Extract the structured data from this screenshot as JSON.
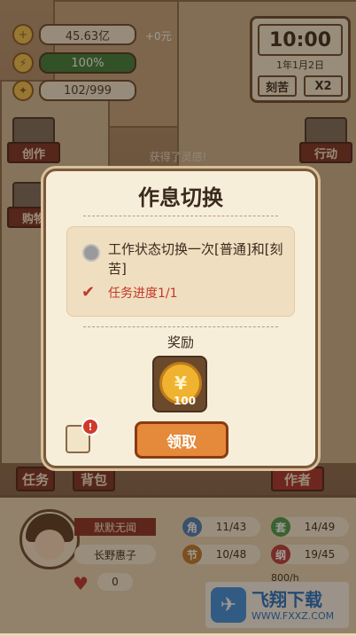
{
  "stats": {
    "money": "45.63亿",
    "money_delta": "+0元",
    "energy": "100%",
    "inspiration": "102/999",
    "money_icon": "coin-plus-icon",
    "energy_icon": "lightning-icon",
    "inspiration_icon": "bulb-icon"
  },
  "clock": {
    "time": "10:00",
    "date": "1年1月2日",
    "mode": "刻苦",
    "speed": "X2"
  },
  "side": {
    "create": "创作",
    "action": "行动",
    "buy": "购物"
  },
  "toast": "获得了灵感!",
  "modal": {
    "title": "作息切换",
    "task_text": "工作状态切换一次[普通]和[刻苦]",
    "progress": "任务进度1/1",
    "reward_title": "奖励",
    "reward_count": "100",
    "reward_icon": "yen-coin-icon",
    "claim": "领取",
    "alert": "!"
  },
  "tabs": {
    "task": "任务",
    "bag": "背包",
    "author": "作者"
  },
  "profile": {
    "title": "默默无闻",
    "name": "长野惠子",
    "hearts": "0",
    "attrs": [
      {
        "badge": "角",
        "value": "11/43"
      },
      {
        "badge": "套",
        "value": "14/49"
      },
      {
        "badge": "节",
        "value": "10/48"
      },
      {
        "badge": "纲",
        "value": "19/45"
      }
    ],
    "rate": "800/h"
  },
  "watermark": {
    "title": "飞翔下载",
    "url": "WWW.FXXZ.COM"
  },
  "colors": {
    "accent": "#e48a3a",
    "ribbon": "#8a2e24",
    "progress_red": "#c0392b"
  }
}
